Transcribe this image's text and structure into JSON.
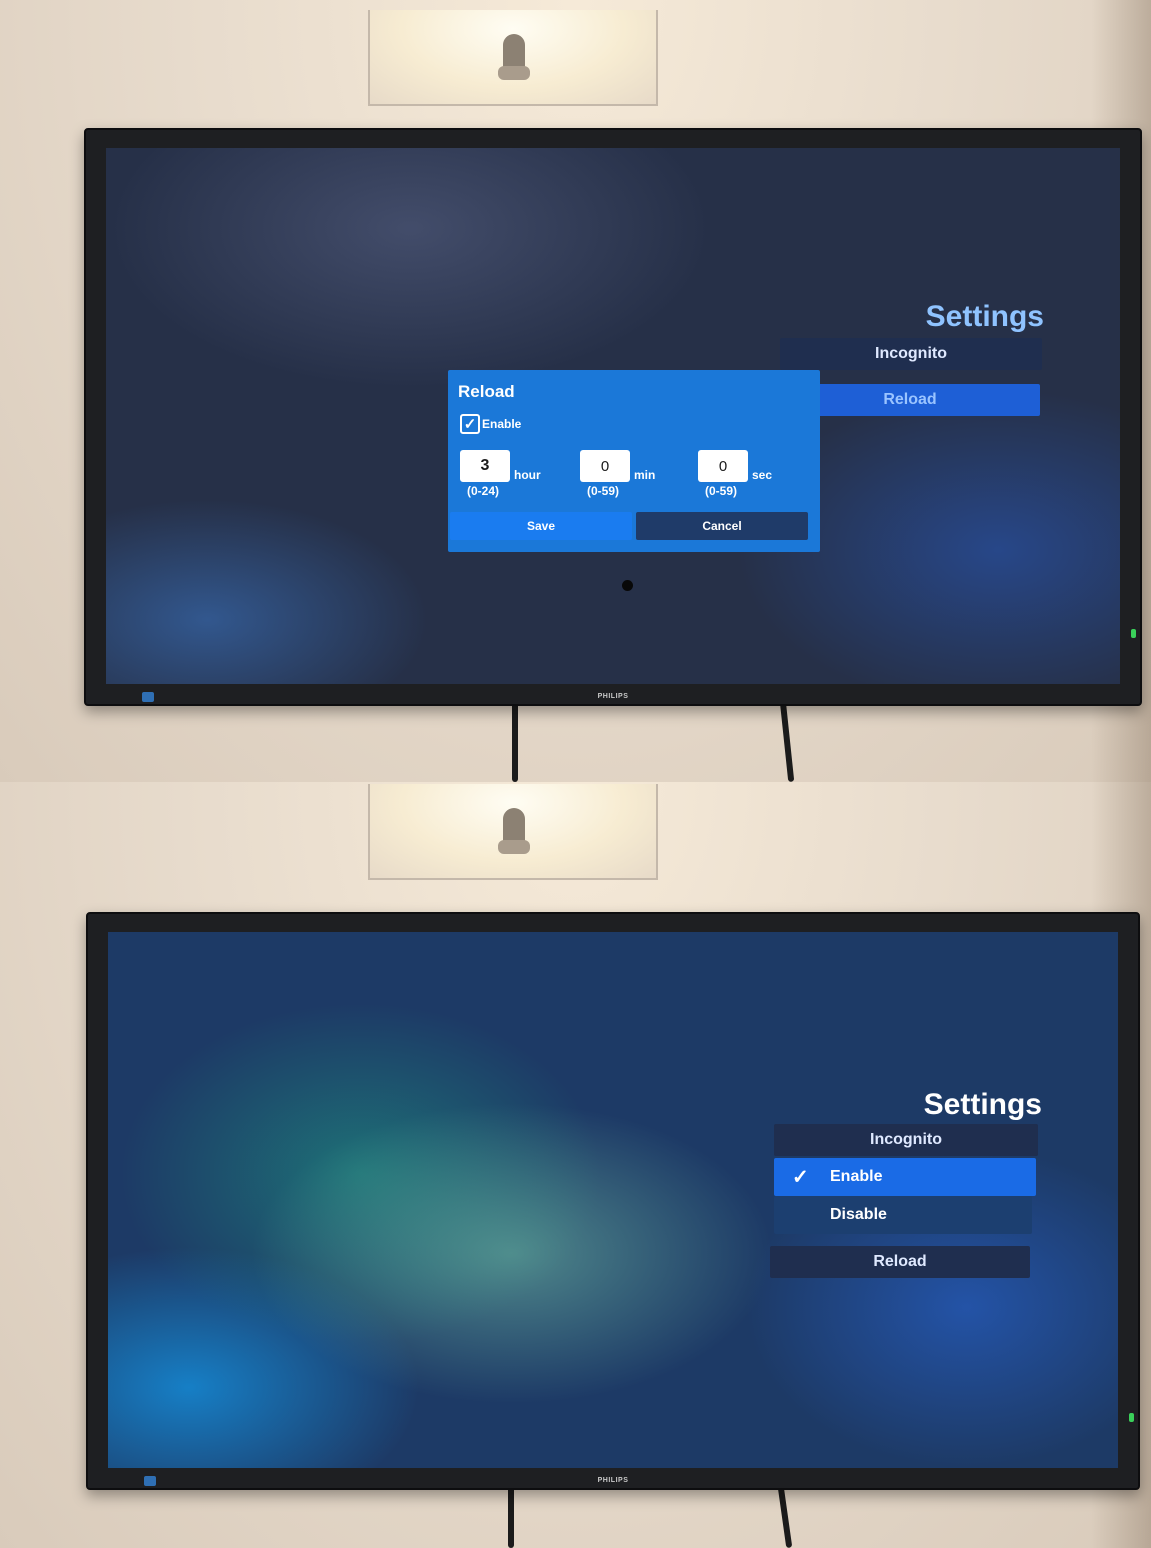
{
  "screen1": {
    "settings": {
      "title": "Settings",
      "items": [
        "Incognito",
        "Reload"
      ]
    },
    "dialog": {
      "title": "Reload",
      "enable_label": "Enable",
      "enable_checked": true,
      "fields": [
        {
          "value": "3",
          "unit": "hour",
          "range": "(0-24)"
        },
        {
          "value": "0",
          "unit": "min",
          "range": "(0-59)"
        },
        {
          "value": "0",
          "unit": "sec",
          "range": "(0-59)"
        }
      ],
      "save_label": "Save",
      "cancel_label": "Cancel"
    },
    "brand": "PHILIPS"
  },
  "screen2": {
    "settings": {
      "title": "Settings",
      "incognito_label": "Incognito",
      "options": [
        {
          "label": "Enable",
          "selected": true
        },
        {
          "label": "Disable",
          "selected": false
        }
      ],
      "reload_label": "Reload"
    },
    "brand": "PHILIPS"
  },
  "icons": {
    "check": "checkmark-icon"
  },
  "colors": {
    "dialog_bg": "#1b78d8",
    "selected_item": "#1a6be6",
    "menu_dark": "#1f2e4f",
    "title_blue": "#8fc3ff"
  }
}
